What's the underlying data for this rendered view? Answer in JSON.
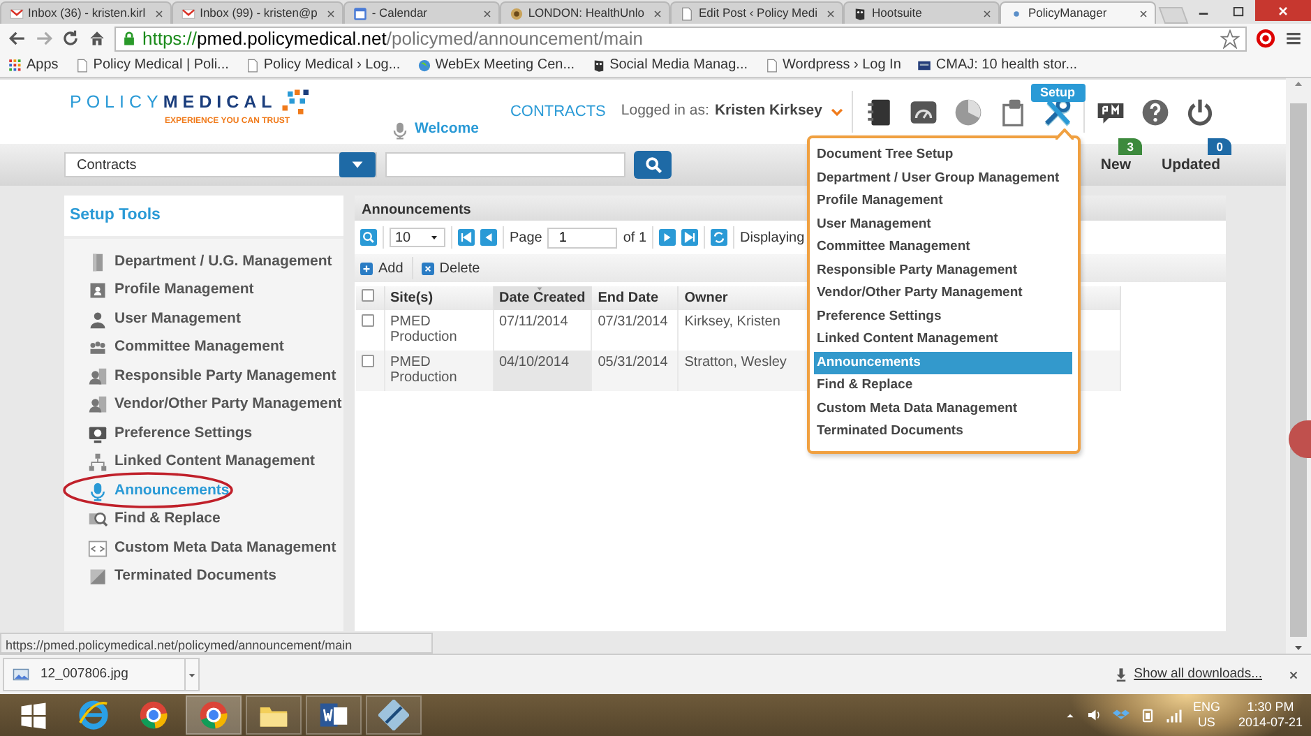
{
  "browser": {
    "tabs": [
      {
        "title": "Inbox (36) - kristen.kirl",
        "kind": "mail",
        "selected": false
      },
      {
        "title": "Inbox (99) - kristen@p",
        "kind": "mail",
        "selected": false
      },
      {
        "title": "- Calendar",
        "kind": "calendar",
        "selected": false
      },
      {
        "title": "LONDON: HealthUnlo",
        "kind": "site",
        "selected": false
      },
      {
        "title": "Edit Post ‹ Policy Medi",
        "kind": "page",
        "selected": false
      },
      {
        "title": "Hootsuite",
        "kind": "owl",
        "selected": false
      },
      {
        "title": "PolicyManager",
        "kind": "dot",
        "selected": true
      }
    ],
    "address": {
      "scheme": "https://",
      "host": "pmed.policymedical.net",
      "path": "/policymed/announcement/main"
    },
    "bookmarks": [
      {
        "label": "Apps",
        "kind": "apps"
      },
      {
        "label": "Policy Medical | Poli...",
        "kind": "page"
      },
      {
        "label": "Policy Medical › Log...",
        "kind": "page"
      },
      {
        "label": "WebEx Meeting Cen...",
        "kind": "globe"
      },
      {
        "label": "Social Media Manag...",
        "kind": "owl"
      },
      {
        "label": "Wordpress › Log In",
        "kind": "page"
      },
      {
        "label": "CMAJ: 10 health stor...",
        "kind": "journal"
      }
    ]
  },
  "app": {
    "logo": {
      "word_a": "POLICY",
      "word_b": "MEDICAL",
      "tagline": "EXPERIENCE YOU CAN TRUST"
    },
    "welcome": "Welcome",
    "contracts": "CONTRACTS",
    "logged_in_label": "Logged in as:",
    "user_name": "Kristen Kirksey",
    "toolbar": [
      {
        "kind": "binder",
        "selected": false
      },
      {
        "kind": "gauge",
        "selected": false
      },
      {
        "kind": "pie",
        "selected": false
      },
      {
        "kind": "clipboard",
        "selected": false
      },
      {
        "kind": "tools",
        "selected": true,
        "tooltip": "Setup"
      },
      {
        "kind": "pm",
        "selected": false
      },
      {
        "kind": "help",
        "selected": false
      },
      {
        "kind": "power",
        "selected": false
      }
    ],
    "badges": [
      {
        "count": "3",
        "label": "New",
        "color": "#3d8a3d"
      },
      {
        "count": "0",
        "label": "Updated",
        "color": "#1e6aa6"
      }
    ],
    "search": {
      "category": "Contracts"
    }
  },
  "sidebar": {
    "title": "Setup Tools",
    "items": [
      {
        "label": "Department / U.G. Management",
        "kind": "door",
        "selected": false,
        "circled": false
      },
      {
        "label": "Profile Management",
        "kind": "profile",
        "selected": false,
        "circled": false
      },
      {
        "label": "User Management",
        "kind": "user",
        "selected": false,
        "circled": false
      },
      {
        "label": "Committee Management",
        "kind": "group",
        "selected": false,
        "circled": false
      },
      {
        "label": "Responsible Party Management",
        "kind": "party",
        "selected": false,
        "circled": false
      },
      {
        "label": "Vendor/Other Party Management",
        "kind": "party",
        "selected": false,
        "circled": false
      },
      {
        "label": "Preference Settings",
        "kind": "monitor",
        "selected": false,
        "circled": false
      },
      {
        "label": "Linked Content Management",
        "kind": "tree",
        "selected": false,
        "circled": false
      },
      {
        "label": "Announcements",
        "kind": "mic",
        "selected": true,
        "circled": true
      },
      {
        "label": "Find & Replace",
        "kind": "find",
        "selected": false,
        "circled": false
      },
      {
        "label": "Custom Meta Data Management",
        "kind": "code",
        "selected": false,
        "circled": false
      },
      {
        "label": "Terminated Documents",
        "kind": "image",
        "selected": false,
        "circled": false
      }
    ]
  },
  "grid": {
    "title": "Announcements",
    "page_size": "10",
    "page_label": "Page",
    "page": "1",
    "page_of": "of 1",
    "displaying": "Displaying",
    "actions": [
      {
        "label": "Add",
        "kind": "add"
      },
      {
        "label": "Delete",
        "kind": "delete"
      }
    ],
    "select_all": false,
    "columns": [
      {
        "label": "Site(s)",
        "sorted": false
      },
      {
        "label": "Date Created",
        "sorted": true
      },
      {
        "label": "End Date",
        "sorted": false
      },
      {
        "label": "Owner",
        "sorted": false
      }
    ],
    "rows": [
      {
        "checked": false,
        "cells": [
          "PMED Production",
          "07/11/2014",
          "07/31/2014",
          "Kirksey, Kristen"
        ]
      },
      {
        "checked": false,
        "cells": [
          "PMED Production",
          "04/10/2014",
          "05/31/2014",
          "Stratton, Wesley"
        ]
      }
    ]
  },
  "setup_menu": {
    "items": [
      {
        "label": "Document Tree Setup",
        "selected": false
      },
      {
        "label": "Department / User Group Management",
        "selected": false
      },
      {
        "label": "Profile Management",
        "selected": false
      },
      {
        "label": "User Management",
        "selected": false
      },
      {
        "label": "Committee Management",
        "selected": false
      },
      {
        "label": "Responsible Party Management",
        "selected": false
      },
      {
        "label": "Vendor/Other Party Management",
        "selected": false
      },
      {
        "label": "Preference Settings",
        "selected": false
      },
      {
        "label": "Linked Content Management",
        "selected": false
      },
      {
        "label": "Announcements",
        "selected": true
      },
      {
        "label": "Find & Replace",
        "selected": false
      },
      {
        "label": "Custom Meta Data Management",
        "selected": false
      },
      {
        "label": "Terminated Documents",
        "selected": false
      }
    ]
  },
  "status_url": "https://pmed.policymedical.net/policymed/announcement/main",
  "downloads": {
    "file": "12_007806.jpg",
    "show_all": "Show all downloads..."
  },
  "taskbar": {
    "apps": [
      {
        "kind": "ie",
        "running": false,
        "selected": false
      },
      {
        "kind": "chrome",
        "running": false,
        "selected": false
      },
      {
        "kind": "chrome",
        "running": true,
        "selected": true
      },
      {
        "kind": "folder",
        "running": true,
        "selected": false
      },
      {
        "kind": "word",
        "running": true,
        "selected": false
      },
      {
        "kind": "tool",
        "running": true,
        "selected": false
      }
    ],
    "lang": "ENG",
    "region": "US",
    "time": "1:30 PM",
    "date": "2014-07-21"
  }
}
